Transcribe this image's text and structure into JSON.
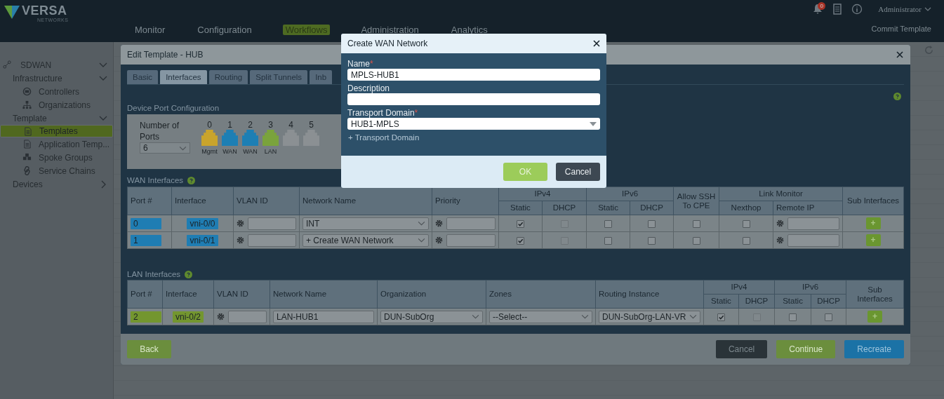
{
  "header": {
    "brand": "VERSA",
    "brand_tagline": "NETWORKS",
    "nav": [
      {
        "label": "Monitor",
        "selected": false
      },
      {
        "label": "Configuration",
        "selected": false
      },
      {
        "label": "Workflows",
        "selected": true
      },
      {
        "label": "Administration",
        "selected": false
      },
      {
        "label": "Analytics",
        "selected": false
      }
    ],
    "alert_count": "0",
    "user": "Administrator",
    "action": "Commit Template"
  },
  "sidebar": {
    "items": [
      {
        "label": "SDWAN",
        "expanded": true,
        "children": [
          {
            "label": "Infrastructure",
            "expanded": true,
            "children": [
              {
                "label": "Controllers",
                "selected": false
              },
              {
                "label": "Organizations",
                "selected": false
              }
            ]
          },
          {
            "label": "Template",
            "expanded": true,
            "children": [
              {
                "label": "Templates",
                "selected": true
              },
              {
                "label": "Application Temp...",
                "selected": false
              },
              {
                "label": "Spoke Groups",
                "selected": false
              },
              {
                "label": "Service Chains",
                "selected": false
              }
            ]
          },
          {
            "label": "Devices",
            "expanded": false
          }
        ]
      }
    ]
  },
  "edit_template": {
    "title": "Edit Template - HUB",
    "tabs": [
      {
        "label": "Basic",
        "selected": false
      },
      {
        "label": "Interfaces",
        "selected": true
      },
      {
        "label": "Routing",
        "selected": false
      },
      {
        "label": "Split Tunnels",
        "selected": false
      },
      {
        "label": "Inb",
        "selected": false
      }
    ],
    "port_config": {
      "title": "Device Port Configuration",
      "ports_label": "Number of Ports",
      "ports_value": "6",
      "ports": [
        {
          "number": "0",
          "label": "Mgmt",
          "color": "#c9a42c"
        },
        {
          "number": "1",
          "label": "WAN",
          "color": "#1d7fb4"
        },
        {
          "number": "2",
          "label": "WAN",
          "color": "#1d7fb4"
        },
        {
          "number": "3",
          "label": "LAN",
          "color": "#7aa33c"
        },
        {
          "number": "4",
          "color": "#8b9093"
        },
        {
          "number": "5",
          "color": "#8b9093"
        }
      ]
    },
    "wan": {
      "title": "WAN Interfaces",
      "columns": [
        "Port #",
        "Interface",
        "VLAN ID",
        "Network Name",
        "Priority",
        "IPv4",
        "IPv6",
        "Allow SSH To CPE",
        "Link Monitor",
        "Sub Interfaces"
      ],
      "subcolumns": [
        "Static",
        "DHCP",
        "Static",
        "DHCP",
        "Nexthop",
        "Remote IP"
      ],
      "rows": [
        {
          "port": "0",
          "interface": "vni-0/0",
          "network": "INT",
          "checks": [
            {
              "checked": true,
              "disabled": false
            },
            {
              "checked": false,
              "disabled": true
            },
            {
              "checked": false,
              "disabled": false
            },
            {
              "checked": false,
              "disabled": false
            },
            {
              "checked": false,
              "disabled": false
            },
            {
              "checked": false,
              "disabled": false
            }
          ],
          "add": "+"
        },
        {
          "port": "1",
          "interface": "vni-0/1",
          "network": "+ Create WAN Network",
          "checks": [
            {
              "checked": true,
              "disabled": false
            },
            {
              "checked": false,
              "disabled": true
            },
            {
              "checked": false,
              "disabled": false
            },
            {
              "checked": false,
              "disabled": false
            },
            {
              "checked": false,
              "disabled": false
            },
            {
              "checked": false,
              "disabled": false
            }
          ],
          "add": "+"
        }
      ]
    },
    "lan": {
      "title": "LAN Interfaces",
      "columns": [
        "Port #",
        "Interface",
        "VLAN ID",
        "Network Name",
        "Organization",
        "Zones",
        "Routing Instance",
        "IPv4",
        "IPv6",
        "Sub Interfaces"
      ],
      "subcolumns": [
        "Static",
        "DHCP",
        "Static",
        "DHCP"
      ],
      "rows": [
        {
          "port": "2",
          "interface": "vni-0/2",
          "network": "LAN-HUB1",
          "organization": "DUN-SubOrg",
          "zones": "--Select--",
          "routing": "DUN-SubOrg-LAN-VR",
          "checks": [
            {
              "checked": true,
              "disabled": false
            },
            {
              "checked": false,
              "disabled": true
            },
            {
              "checked": false,
              "disabled": false
            },
            {
              "checked": false,
              "disabled": false
            }
          ],
          "add": "+"
        }
      ]
    },
    "buttons": [
      {
        "label": "Back",
        "kind": "back"
      },
      {
        "label": "Cancel",
        "kind": "cancel"
      },
      {
        "label": "Continue",
        "kind": "next"
      },
      {
        "label": "Recreate",
        "kind": "submit"
      }
    ]
  },
  "dialog": {
    "title": "Create WAN Network",
    "required_mark": "*",
    "fields": [
      {
        "label": "Name",
        "required": true,
        "kind": "text",
        "value": "MPLS-HUB1"
      },
      {
        "label": "Description",
        "required": false,
        "kind": "text"
      },
      {
        "label": "Transport Domain",
        "required": true,
        "kind": "select",
        "value": "HUB1-MPLS"
      }
    ],
    "link": "+ Transport Domain",
    "buttons": [
      {
        "label": "OK",
        "kind": "ok"
      },
      {
        "label": "Cancel",
        "kind": "cancel"
      }
    ]
  }
}
